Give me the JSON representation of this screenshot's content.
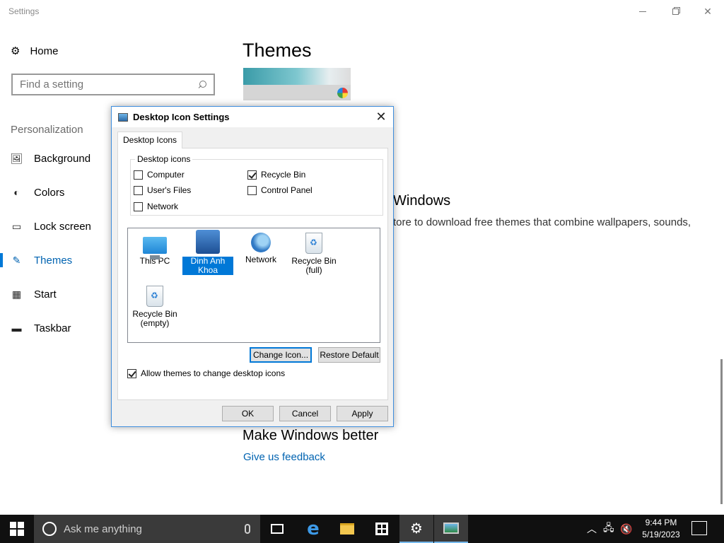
{
  "window": {
    "title": "Settings"
  },
  "sidebar": {
    "home": "Home",
    "search_placeholder": "Find a setting",
    "section": "Personalization",
    "items": [
      {
        "label": "Background",
        "icon": "picture-icon"
      },
      {
        "label": "Colors",
        "icon": "palette-icon"
      },
      {
        "label": "Lock screen",
        "icon": "lock-screen-icon"
      },
      {
        "label": "Themes",
        "icon": "themes-icon",
        "active": true
      },
      {
        "label": "Start",
        "icon": "start-tiles-icon"
      },
      {
        "label": "Taskbar",
        "icon": "taskbar-icon"
      }
    ]
  },
  "main": {
    "title": "Themes",
    "store_heading": "Windows",
    "store_text": "tore to download free themes that combine wallpapers, sounds,",
    "better_heading": "Make Windows better",
    "feedback_link": "Give us feedback"
  },
  "dialog": {
    "title": "Desktop Icon Settings",
    "tab": "Desktop Icons",
    "group_label": "Desktop icons",
    "checkboxes": [
      {
        "label": "Computer",
        "checked": false
      },
      {
        "label": "User's Files",
        "checked": false
      },
      {
        "label": "Network",
        "checked": false
      },
      {
        "label": "Recycle Bin",
        "checked": true
      },
      {
        "label": "Control Panel",
        "checked": false
      }
    ],
    "icons": [
      {
        "label": "This PC",
        "icon": "this-pc-icon"
      },
      {
        "label": "Dinh Anh Khoa",
        "icon": "user-files-icon",
        "selected": true
      },
      {
        "label": "Network",
        "icon": "network-icon"
      },
      {
        "label": "Recycle Bin (full)",
        "icon": "recycle-bin-full-icon"
      },
      {
        "label": "Recycle Bin (empty)",
        "icon": "recycle-bin-empty-icon"
      }
    ],
    "change_icon": "Change Icon...",
    "restore_default": "Restore Default",
    "allow_themes": "Allow themes to change desktop icons",
    "allow_themes_checked": true,
    "ok": "OK",
    "cancel": "Cancel",
    "apply": "Apply"
  },
  "taskbar": {
    "search_placeholder": "Ask me anything",
    "time": "9:44 PM",
    "date": "5/19/2023",
    "accent": "#76b9ed"
  }
}
